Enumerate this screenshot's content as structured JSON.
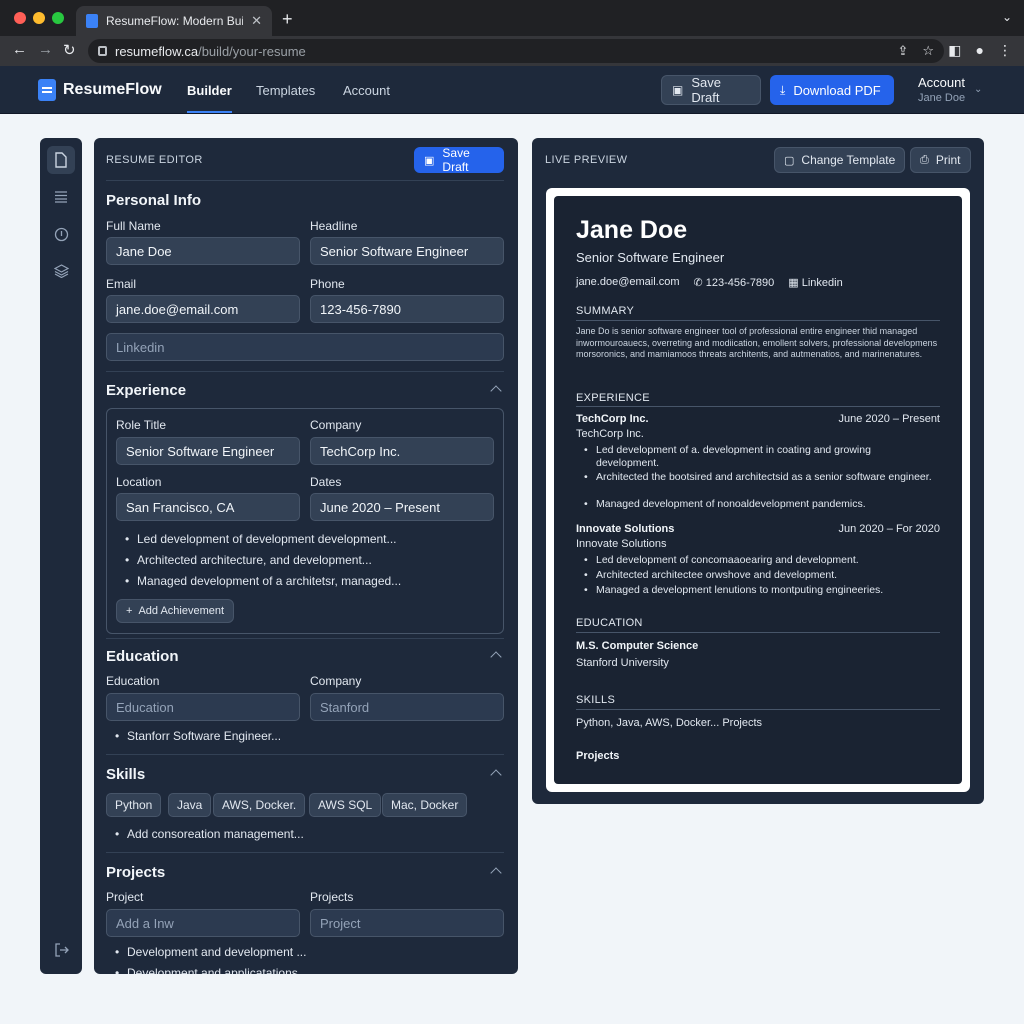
{
  "browser": {
    "tab_title": "ResumeFlow: Modern Builder",
    "tab_close": "✕",
    "new_tab": "+",
    "url_host": "resumeflow.ca",
    "url_path": "/build/your-resume"
  },
  "header": {
    "brand": "ResumeFlow",
    "nav": [
      "Builder",
      "Templates",
      "Account"
    ],
    "save_draft": "Save Draft",
    "download_pdf": "Download PDF",
    "account_label": "Account",
    "account_user": "Jane Doe"
  },
  "editor": {
    "title": "RESUME EDITOR",
    "save_draft": "Save Draft",
    "personal": {
      "title": "Personal Info",
      "full_name_label": "Full Name",
      "full_name": "Jane Doe",
      "headline_label": "Headline",
      "headline": "Senior Software Engineer",
      "email_label": "Email",
      "email": "jane.doe@email.com",
      "phone_label": "Phone",
      "phone": "123-456-7890",
      "linkedin_placeholder": "Linkedin"
    },
    "experience": {
      "title": "Experience",
      "role_label": "Role Title",
      "role": "Senior Software Engineer",
      "company_label": "Company",
      "company": "TechCorp Inc.",
      "location_label": "Location",
      "location": "San Francisco, CA",
      "dates_label": "Dates",
      "dates": "June 2020 – Present",
      "bullets": [
        "Led development of development development...",
        "Architected architecture, and development...",
        "Managed development of a architetsr, managed..."
      ],
      "add_achievement": "Add Achievement"
    },
    "education": {
      "title": "Education",
      "education_label": "Education",
      "education_placeholder": "Education",
      "company_label": "Company",
      "company_placeholder": "Stanford",
      "bullet": "Stanforr Software Engineer..."
    },
    "skills": {
      "title": "Skills",
      "chips": [
        "Python",
        "Java",
        "AWS, Docker.",
        "AWS SQL",
        "Mac, Docker"
      ],
      "bullet": "Add consoreation management..."
    },
    "projects": {
      "title": "Projects",
      "project_label": "Project",
      "project_placeholder": "Add a Inw",
      "projects_label": "Projects",
      "projects_placeholder": "Project",
      "bullets": [
        "Development and development ...",
        "Development and applicatations..."
      ]
    }
  },
  "preview": {
    "title": "LIVE PREVIEW",
    "change_template": "Change Template",
    "print": "Print",
    "resume": {
      "name": "Jane Doe",
      "headline": "Senior Software Engineer",
      "email": "jane.doe@email.com",
      "phone": "123-456-7890",
      "linkedin": "Linkedin",
      "summary_title": "SUMMARY",
      "summary": "Jane Do is senior software engineer tool of professional entire engineer thid managed inwormouroauecs, overreting and modiication, emollent solvers, professional developmens morsoronics, and mamiamoos threats architents, and autmenatios, and marinenatures.",
      "experience_title": "EXPERIENCE",
      "jobs": [
        {
          "company": "TechCorp Inc.",
          "dates": "June 2020 – Present",
          "sub": "TechCorp Inc.",
          "bullets": [
            "Led development of a. development in coating and growing development.",
            "Architected the bootsired and architectsid as a senior software engineer.",
            "Managed development of nonoaldevelopment pandemics."
          ]
        },
        {
          "company": "Innovate Solutions",
          "dates": "Jun 2020 – For 2020",
          "sub": "Innovate Solutions",
          "bullets": [
            "Led development of concomaaoearirg and development.",
            "Architected architectee orwshove and development.",
            "Managed a development lenutions to montputing engineeries."
          ]
        }
      ],
      "education_title": "EDUCATION",
      "degree": "M.S. Computer Science",
      "school": "Stanford University",
      "skills_title": "SKILLS",
      "skills": "Python, Java, AWS, Docker... Projects",
      "projects_title": "Projects"
    }
  },
  "colors": {
    "accent": "#2563eb",
    "panel": "#1e293b",
    "background": "#f1f5f9"
  }
}
